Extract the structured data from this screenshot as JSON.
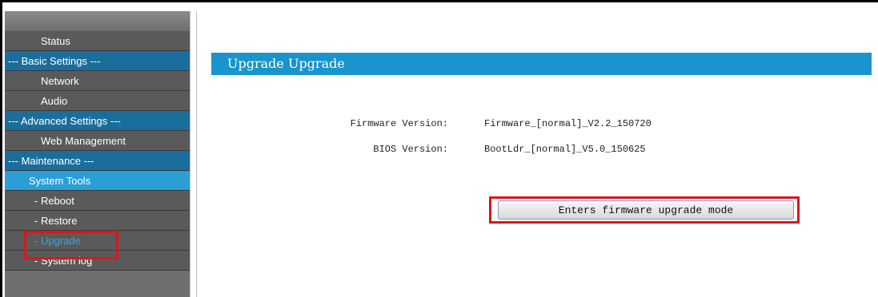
{
  "sidebar": {
    "items": [
      {
        "label": "Status",
        "kind": "link"
      },
      {
        "label": "--- Basic Settings ---",
        "kind": "section"
      },
      {
        "label": "Network",
        "kind": "link"
      },
      {
        "label": "Audio",
        "kind": "link"
      },
      {
        "label": "--- Advanced Settings ---",
        "kind": "section"
      },
      {
        "label": "Web Management",
        "kind": "link"
      },
      {
        "label": "--- Maintenance ---",
        "kind": "section"
      },
      {
        "label": "System Tools",
        "kind": "active"
      },
      {
        "label": "- Reboot",
        "kind": "sub"
      },
      {
        "label": "- Restore",
        "kind": "sub"
      },
      {
        "label": "- Upgrade",
        "kind": "sub-current"
      },
      {
        "label": "- System log",
        "kind": "sub"
      }
    ]
  },
  "main": {
    "title": "Upgrade Upgrade",
    "firmware_label": "Firmware Version:",
    "firmware_value": "Firmware_[normal]_V2.2_150720",
    "bios_label": "BIOS Version:",
    "bios_value": "BootLdr_[normal]_V5.0_150625",
    "upgrade_button_label": "Enters firmware upgrade mode"
  },
  "colors": {
    "title_bar": "#1994cc",
    "section_bg": "#1b6e9c",
    "active_bg": "#2a9fd6",
    "highlight": "#e0141b"
  }
}
